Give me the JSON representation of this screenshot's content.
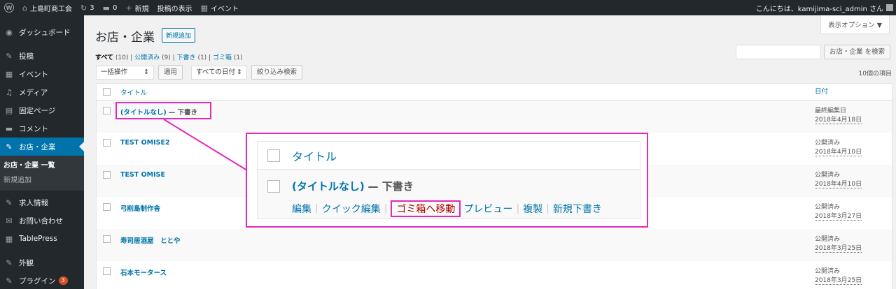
{
  "adminbar": {
    "site_name": "上島町商工会",
    "updates": "3",
    "comments": "0",
    "new_label": "新規",
    "view_posts": "投稿の表示",
    "events": "イベント",
    "greeting": "こんにちは、kamijima-sci_admin さん"
  },
  "sidebar": {
    "items": [
      {
        "icon": "dashboard-icon",
        "glyph": "◉",
        "label": "ダッシュボード"
      },
      {
        "icon": "pin-icon",
        "glyph": "✎",
        "label": "投稿"
      },
      {
        "icon": "calendar-icon",
        "glyph": "▦",
        "label": "イベント"
      },
      {
        "icon": "media-icon",
        "glyph": "♫",
        "label": "メディア"
      },
      {
        "icon": "page-icon",
        "glyph": "▤",
        "label": "固定ページ"
      },
      {
        "icon": "comment-icon",
        "glyph": "▬",
        "label": "コメント"
      },
      {
        "icon": "pin-icon",
        "glyph": "✎",
        "label": "お店・企業"
      }
    ],
    "submenu": [
      "お店・企業 一覧",
      "新規追加"
    ],
    "items_after": [
      {
        "icon": "pin-icon",
        "glyph": "✎",
        "label": "求人情報"
      },
      {
        "icon": "mail-icon",
        "glyph": "✉",
        "label": "お問い合わせ"
      },
      {
        "icon": "table-icon",
        "glyph": "▦",
        "label": "TablePress"
      },
      {
        "icon": "appearance-icon",
        "glyph": "✎",
        "label": "外観"
      },
      {
        "icon": "plugin-icon",
        "glyph": "✎",
        "label": "プラグイン",
        "badge": "3"
      }
    ]
  },
  "main": {
    "title": "お店・企業",
    "add_new": "新規追加",
    "screen_options": "表示オプション ▼",
    "filters": {
      "all": "すべて",
      "all_count": "(10)",
      "published": "公開済み",
      "published_count": "(9)",
      "draft": "下書き",
      "draft_count": "(1)",
      "trash": "ゴミ箱",
      "trash_count": "(1)"
    },
    "search_button": "お店・企業 を検索",
    "bulk_select": "一括操作",
    "apply": "適用",
    "date_select": "すべての日付",
    "filter_button": "絞り込み検索",
    "items_count": "10個の項目",
    "col_title": "タイトル",
    "col_date": "日付",
    "rows": [
      {
        "title": "(タイトルなし)",
        "state": "— 下書き",
        "status": "最終編集日",
        "date": "2018年4月18日"
      },
      {
        "title": "TEST OMISE2",
        "state": "",
        "status": "公開済み",
        "date": "2018年4月10日"
      },
      {
        "title": "TEST OMISE",
        "state": "",
        "status": "公開済み",
        "date": "2018年4月10日"
      },
      {
        "title": "弓削島制作舎",
        "state": "",
        "status": "公開済み",
        "date": "2018年3月27日"
      },
      {
        "title": "寿司居酒屋　ととや",
        "state": "",
        "status": "公開済み",
        "date": "2018年3月25日"
      },
      {
        "title": "石本モータース",
        "state": "",
        "status": "公開済み",
        "date": "2018年3月25日"
      }
    ]
  },
  "zoom": {
    "col_title": "タイトル",
    "title": "(タイトルなし)",
    "state": "— 下書き",
    "actions": {
      "edit": "編集",
      "quick_edit": "クイック編集",
      "trash": "ゴミ箱へ移動",
      "preview": "プレビュー",
      "duplicate": "複製",
      "new_draft": "新規下書き"
    }
  },
  "colors": {
    "highlight": "#e22ab8",
    "link": "#0073aa",
    "admin_bg": "#23282d",
    "current_menu": "#0073aa",
    "trash": "#a00"
  }
}
